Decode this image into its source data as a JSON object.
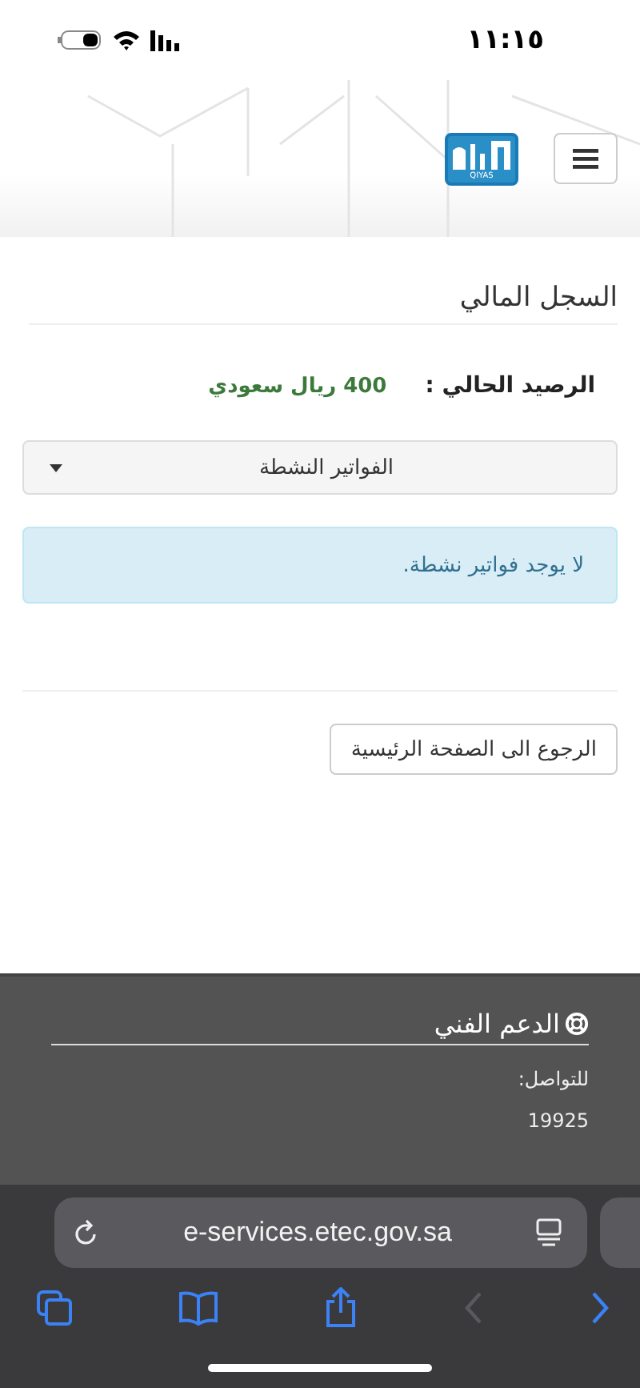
{
  "status_bar": {
    "time": "١١:١٥"
  },
  "header": {
    "logo_text": "QIYAS"
  },
  "page": {
    "title": "السجل المالي",
    "balance_label": "الرصيد الحالي :",
    "balance_value": "400 ريال سعودي",
    "dropdown": {
      "value": "الفواتير النشطة"
    },
    "alert": "لا يوجد فواتير نشطة.",
    "back_button": "الرجوع الى الصفحة الرئيسية"
  },
  "footer": {
    "title": "الدعم الفني",
    "contact_label": "للتواصل:",
    "phone": "19925"
  },
  "browser": {
    "url": "e-services.etec.gov.sa",
    "nav": [
      {
        "kind": "back",
        "disabled": true
      },
      {
        "kind": "forward",
        "disabled": false
      }
    ]
  }
}
